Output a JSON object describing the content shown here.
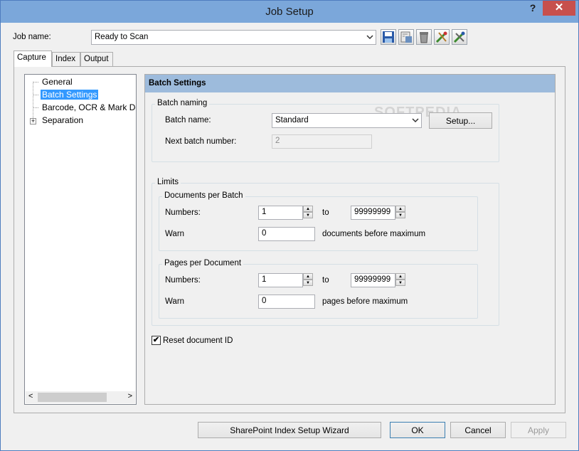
{
  "window": {
    "title": "Job Setup",
    "help_glyph": "?",
    "close_glyph": "✕"
  },
  "job": {
    "label": "Job name:",
    "value": "Ready to Scan"
  },
  "toolbar_icons": [
    "save-icon",
    "save-as-icon",
    "delete-icon",
    "settings-wizard-icon",
    "tools-icon"
  ],
  "tabs": [
    {
      "label": "Capture"
    },
    {
      "label": "Index"
    },
    {
      "label": "Output"
    }
  ],
  "tree": {
    "items": [
      {
        "label": "General"
      },
      {
        "label": "Batch Settings"
      },
      {
        "label": "Barcode, OCR & Mark De"
      },
      {
        "label": "Separation",
        "expander": "+"
      }
    ],
    "scroll_left": "<",
    "scroll_right": ">"
  },
  "panel": {
    "title": "Batch Settings",
    "batch_naming": {
      "group_label": "Batch naming",
      "name_label": "Batch name:",
      "name_value": "Standard",
      "setup_button": "Setup...",
      "next_label": "Next batch number:",
      "next_value": "2"
    },
    "limits": {
      "group_label": "Limits",
      "docs": {
        "group_label": "Documents per Batch",
        "numbers_label": "Numbers:",
        "from_value": "1",
        "to_label": "to",
        "to_value": "99999999",
        "warn_label": "Warn",
        "warn_value": "0",
        "warn_suffix": "documents before maximum"
      },
      "pages": {
        "group_label": "Pages per Document",
        "numbers_label": "Numbers:",
        "from_value": "1",
        "to_label": "to",
        "to_value": "99999999",
        "warn_label": "Warn",
        "warn_value": "0",
        "warn_suffix": "pages before maximum"
      }
    },
    "reset_label": "Reset document ID",
    "reset_checked": true,
    "check_glyph": "✔"
  },
  "footer": {
    "wizard_button": "SharePoint Index Setup Wizard",
    "ok_button": "OK",
    "cancel_button": "Cancel",
    "apply_button": "Apply"
  },
  "watermark": "SOFTPEDIA",
  "spin_up": "▲",
  "spin_down": "▼"
}
